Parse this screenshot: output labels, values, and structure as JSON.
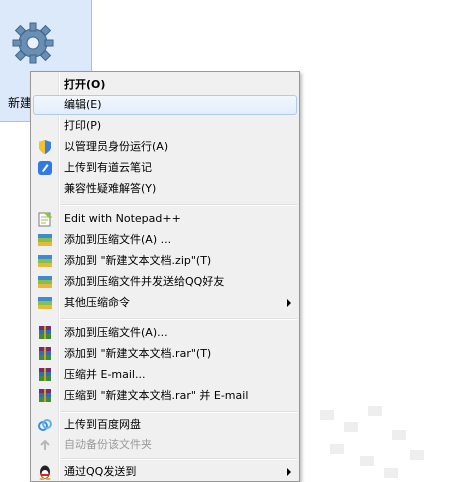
{
  "desktop_icon": {
    "label": "新建"
  },
  "menu": {
    "items": [
      {
        "label": "打开(O)"
      },
      {
        "label": "编辑(E)"
      },
      {
        "label": "打印(P)"
      },
      {
        "label": "以管理员身份运行(A)"
      },
      {
        "label": "上传到有道云笔记"
      },
      {
        "label": "兼容性疑难解答(Y)"
      },
      {
        "label": "Edit with Notepad++"
      },
      {
        "label": "添加到压缩文件(A) ..."
      },
      {
        "label": "添加到 \"新建文本文档.zip\"(T)"
      },
      {
        "label": "添加到压缩文件并发送给QQ好友"
      },
      {
        "label": "其他压缩命令"
      },
      {
        "label": "添加到压缩文件(A)..."
      },
      {
        "label": "添加到 \"新建文本文档.rar\"(T)"
      },
      {
        "label": "压缩并 E-mail..."
      },
      {
        "label": "压缩到 \"新建文本文档.rar\" 并 E-mail"
      },
      {
        "label": "上传到百度网盘"
      },
      {
        "label": "自动备份该文件夹"
      },
      {
        "label": "通过QQ发送到"
      }
    ]
  },
  "colors": {
    "menu_bg": "#f0f0f0",
    "hover_border": "#aecbf0",
    "selection": "#dbe9fa"
  }
}
